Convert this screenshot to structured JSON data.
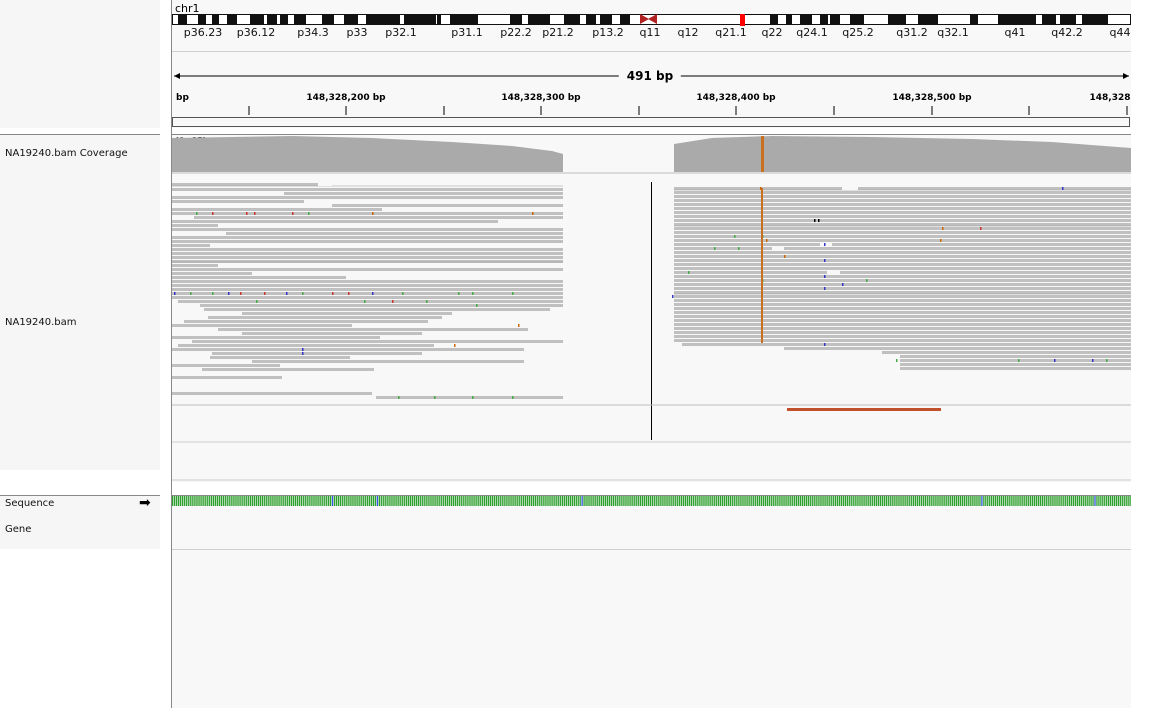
{
  "chromosome": "chr1",
  "cytobands": [
    "p36.23",
    "p36.12",
    "p34.3",
    "p33",
    "p32.1",
    "p31.1",
    "p22.2",
    "p21.2",
    "p13.2",
    "q11",
    "q12",
    "q21.1",
    "q22",
    "q24.1",
    "q25.2",
    "q31.2",
    "q32.1",
    "q41",
    "q42.2",
    "q44"
  ],
  "span_label": "491 bp",
  "ruler": {
    "left_label": "bp",
    "ticks": [
      "148,328,200 bp",
      "148,328,300 bp",
      "148,328,400 bp",
      "148,328,500 bp",
      "148,328"
    ]
  },
  "tracks": {
    "coverage_name": "NA19240.bam Coverage",
    "coverage_range": "[0 - 27]",
    "alignment_name": "NA19240.bam",
    "sequence_name": "Sequence",
    "gene_name": "Gene"
  },
  "colors": {
    "read": "#c0c0c0",
    "coverage": "#aaaaaa",
    "mismatch_orange": "#c87020",
    "paired_read": "#c0502a",
    "ideogram_dark": "#111111",
    "centromere": "#b22222",
    "current_region": "#ff0000"
  }
}
